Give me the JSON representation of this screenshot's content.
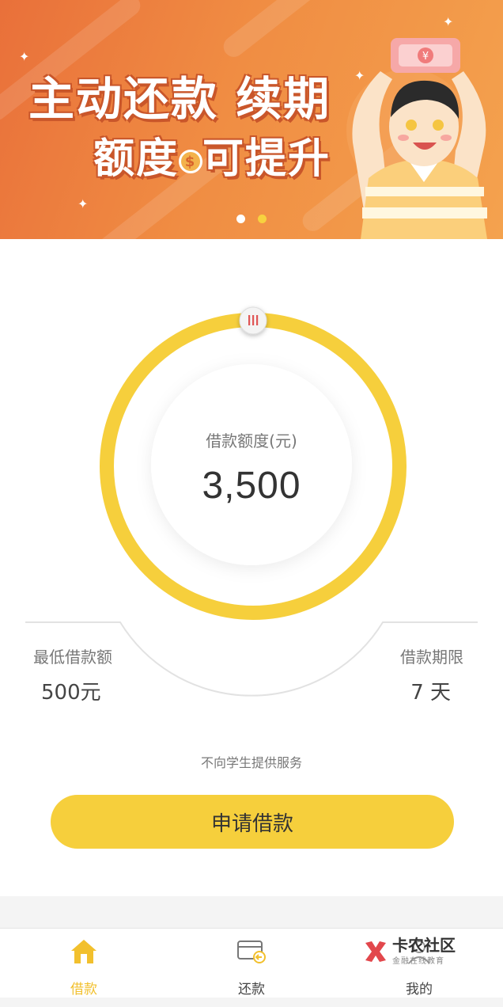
{
  "banner": {
    "line1": "主动还款 续期",
    "line2_a": "额度",
    "line2_coin": "$",
    "line2_b": "可提升",
    "active_dot_color": "#ffffff",
    "inactive_dot_color": "#f7d23f"
  },
  "loan": {
    "amount_label": "借款额度(元)",
    "amount_value": "3,500",
    "min_label": "最低借款额",
    "min_value": "500元",
    "term_label": "借款期限",
    "term_value": "7 天",
    "handle_icon": "slider-handle-icon",
    "ring_color": "#f6cf3c"
  },
  "notice": "不向学生提供服务",
  "apply_button": {
    "label": "申请借款",
    "color": "#f6cf3c"
  },
  "tabs": [
    {
      "label": "借款",
      "icon": "home-icon",
      "active": true
    },
    {
      "label": "还款",
      "icon": "repay-card-icon",
      "active": false
    },
    {
      "label": "我的",
      "icon": "profile-icon",
      "active": false
    }
  ],
  "watermark": {
    "title": "卡农社区",
    "subtitle": "金融在线教育"
  },
  "colors": {
    "accent": "#f6cf3c",
    "active_tab": "#f2c02d",
    "banner_orange": "#f08d43"
  }
}
